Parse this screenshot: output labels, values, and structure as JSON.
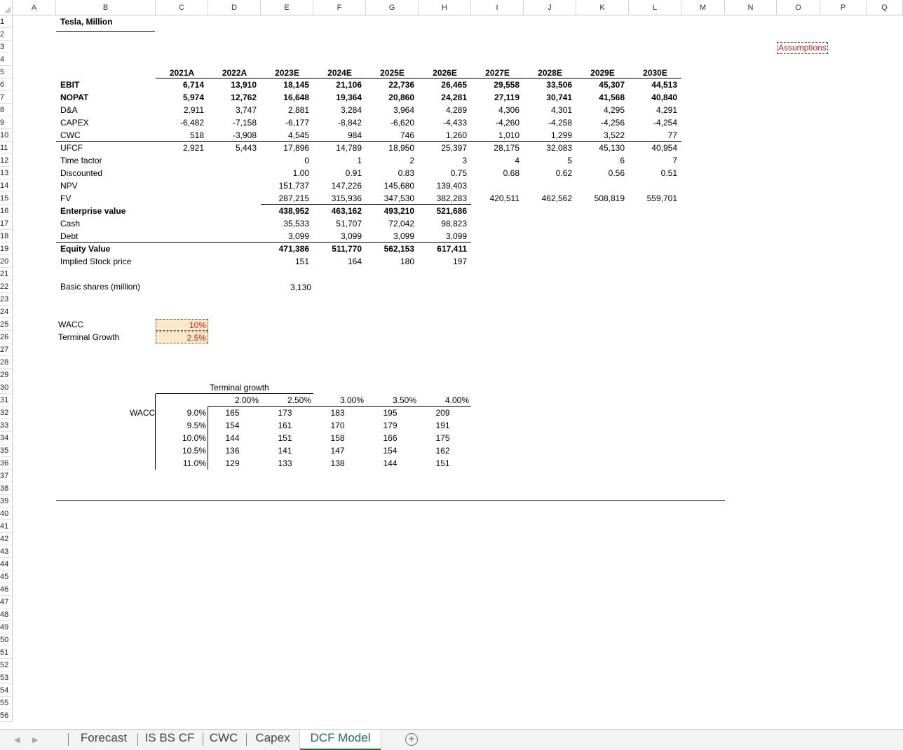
{
  "sheet_title": "Tesla, Million",
  "assumptions_label": "Assumptions",
  "columns": [
    "A",
    "B",
    "C",
    "D",
    "E",
    "F",
    "G",
    "H",
    "I",
    "J",
    "K",
    "L",
    "M",
    "N",
    "O",
    "P",
    "Q"
  ],
  "rows": [
    "1",
    "2",
    "3",
    "4",
    "5",
    "6",
    "7",
    "8",
    "9",
    "10",
    "11",
    "12",
    "13",
    "14",
    "15",
    "16",
    "17",
    "18",
    "19",
    "20",
    "21",
    "22",
    "23",
    "24",
    "25",
    "26",
    "27",
    "28",
    "29",
    "30",
    "31",
    "32",
    "33",
    "34",
    "35",
    "36",
    "37",
    "38",
    "39",
    "40",
    "41",
    "42",
    "43",
    "44",
    "45",
    "46",
    "47",
    "48",
    "49",
    "50",
    "51",
    "52",
    "53",
    "54",
    "55",
    "56"
  ],
  "years": [
    "2021A",
    "2022A",
    "2023E",
    "2024E",
    "2025E",
    "2026E",
    "2027E",
    "2028E",
    "2029E",
    "2030E"
  ],
  "table": [
    {
      "label": "EBIT",
      "bold": true,
      "values": [
        "6,714",
        "13,910",
        "18,145",
        "21,106",
        "22,736",
        "26,465",
        "29,558",
        "33,506",
        "45,307",
        "44,513"
      ]
    },
    {
      "label": "NOPAT",
      "bold": true,
      "values": [
        "5,974",
        "12,762",
        "16,648",
        "19,364",
        "20,860",
        "24,281",
        "27,119",
        "30,741",
        "41,568",
        "40,840"
      ]
    },
    {
      "label": "D&A",
      "bold": false,
      "values": [
        "2,911",
        "3,747",
        "2,881",
        "3,284",
        "3,964",
        "4,289",
        "4,306",
        "4,301",
        "4,295",
        "4,291"
      ]
    },
    {
      "label": "CAPEX",
      "bold": false,
      "values": [
        "-6,482",
        "-7,158",
        "-6,177",
        "-8,842",
        "-6,620",
        "-4,433",
        "-4,260",
        "-4,258",
        "-4,256",
        "-4,254"
      ]
    },
    {
      "label": "CWC",
      "bold": false,
      "values": [
        "518",
        "-3,908",
        "4,545",
        "984",
        "746",
        "1,260",
        "1,010",
        "1,299",
        "3,522",
        "77"
      ]
    },
    {
      "label": "UFCF",
      "bold": false,
      "values": [
        "2,921",
        "5,443",
        "17,896",
        "14,789",
        "18,950",
        "25,397",
        "28,175",
        "32,083",
        "45,130",
        "40,954"
      ]
    },
    {
      "label": "Time factor",
      "bold": false,
      "values": [
        "",
        "",
        "0",
        "1",
        "2",
        "3",
        "4",
        "5",
        "6",
        "7"
      ]
    },
    {
      "label": "Discounted",
      "bold": false,
      "values": [
        "",
        "",
        "1.00",
        "0.91",
        "0.83",
        "0.75",
        "0.68",
        "0.62",
        "0.56",
        "0.51"
      ]
    },
    {
      "label": "NPV",
      "bold": false,
      "values": [
        "",
        "",
        "151,737",
        "147,226",
        "145,680",
        "139,403",
        "",
        "",
        "",
        ""
      ]
    },
    {
      "label": "FV",
      "bold": false,
      "values": [
        "",
        "",
        "287,215",
        "315,936",
        "347,530",
        "382,283",
        "420,511",
        "462,562",
        "508,819",
        "559,701"
      ]
    },
    {
      "label": "Enterprise value",
      "bold": true,
      "values": [
        "",
        "",
        "438,952",
        "463,162",
        "493,210",
        "521,686",
        "",
        "",
        "",
        ""
      ]
    },
    {
      "label": "Cash",
      "bold": false,
      "values": [
        "",
        "",
        "35,533",
        "51,707",
        "72,042",
        "98,823",
        "",
        "",
        "",
        ""
      ]
    },
    {
      "label": "Debt",
      "bold": false,
      "values": [
        "",
        "",
        "3,099",
        "3,099",
        "3,099",
        "3,099",
        "",
        "",
        "",
        ""
      ]
    },
    {
      "label": "Equity Value",
      "bold": true,
      "values": [
        "",
        "",
        "471,386",
        "511,770",
        "562,153",
        "617,411",
        "",
        "",
        "",
        ""
      ]
    },
    {
      "label": "Implied Stock price",
      "bold": false,
      "values": [
        "",
        "",
        "151",
        "164",
        "180",
        "197",
        "",
        "",
        "",
        ""
      ]
    }
  ],
  "basic_shares": {
    "label": "Basic shares (million)",
    "value": "3,130"
  },
  "wacc": {
    "label": "WACC",
    "value": "10%"
  },
  "terminal_growth": {
    "label": "Terminal Growth",
    "value": "2.5%"
  },
  "sensitivity": {
    "title": "Terminal growth",
    "row_label": "WACC",
    "growth": [
      "2.00%",
      "2.50%",
      "3.00%",
      "3.50%",
      "4.00%"
    ],
    "wacc": [
      "9.0%",
      "9.5%",
      "10.0%",
      "10.5%",
      "11.0%"
    ],
    "values": [
      [
        "165",
        "173",
        "183",
        "195",
        "209"
      ],
      [
        "154",
        "161",
        "170",
        "179",
        "191"
      ],
      [
        "144",
        "151",
        "158",
        "166",
        "175"
      ],
      [
        "136",
        "141",
        "147",
        "154",
        "162"
      ],
      [
        "129",
        "133",
        "138",
        "144",
        "151"
      ]
    ]
  },
  "tabs": [
    "Forecast",
    "IS BS CF",
    "CWC",
    "Capex",
    "DCF Model"
  ],
  "active_tab": "DCF Model",
  "add_sheet_icon": "plus-circle-icon",
  "nav_icons": [
    "prev-sheet-icon",
    "next-sheet-icon"
  ]
}
